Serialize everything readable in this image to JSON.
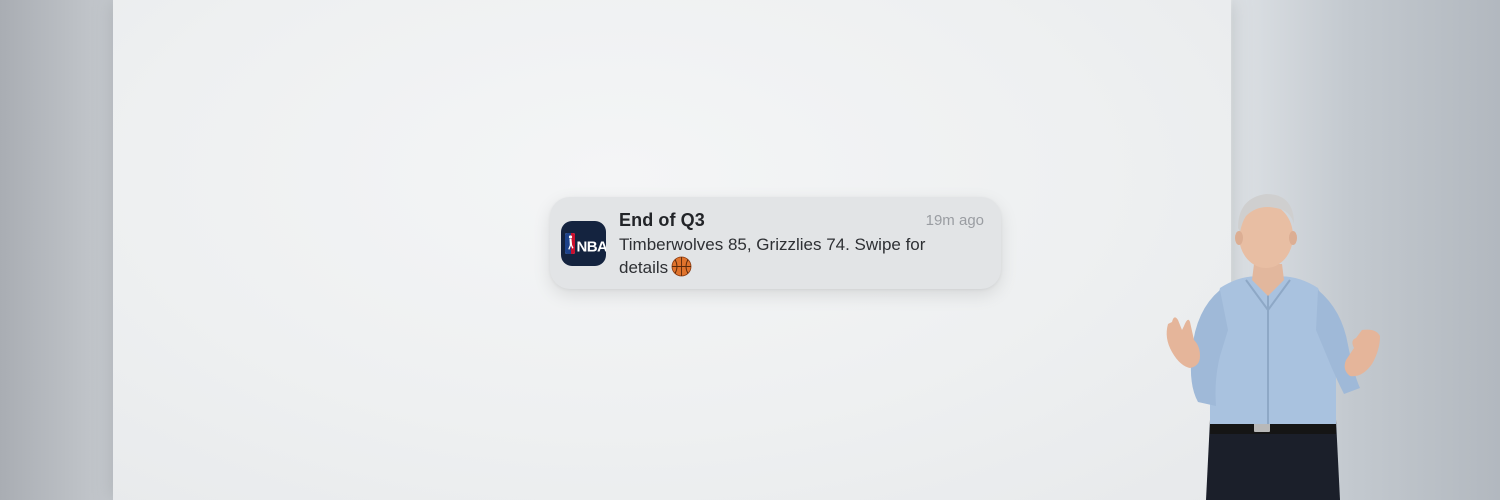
{
  "notification": {
    "app_name": "NBA",
    "title": "End of Q3",
    "time": "19m ago",
    "body": "Timberwolves 85, Grizzlies 74. Swipe for details",
    "app_icon": "nba-logo-icon",
    "trailing_icon": "basketball-icon",
    "app_icon_color": "#14233f"
  },
  "scene": {
    "presenter": "person-standing-presenting"
  }
}
